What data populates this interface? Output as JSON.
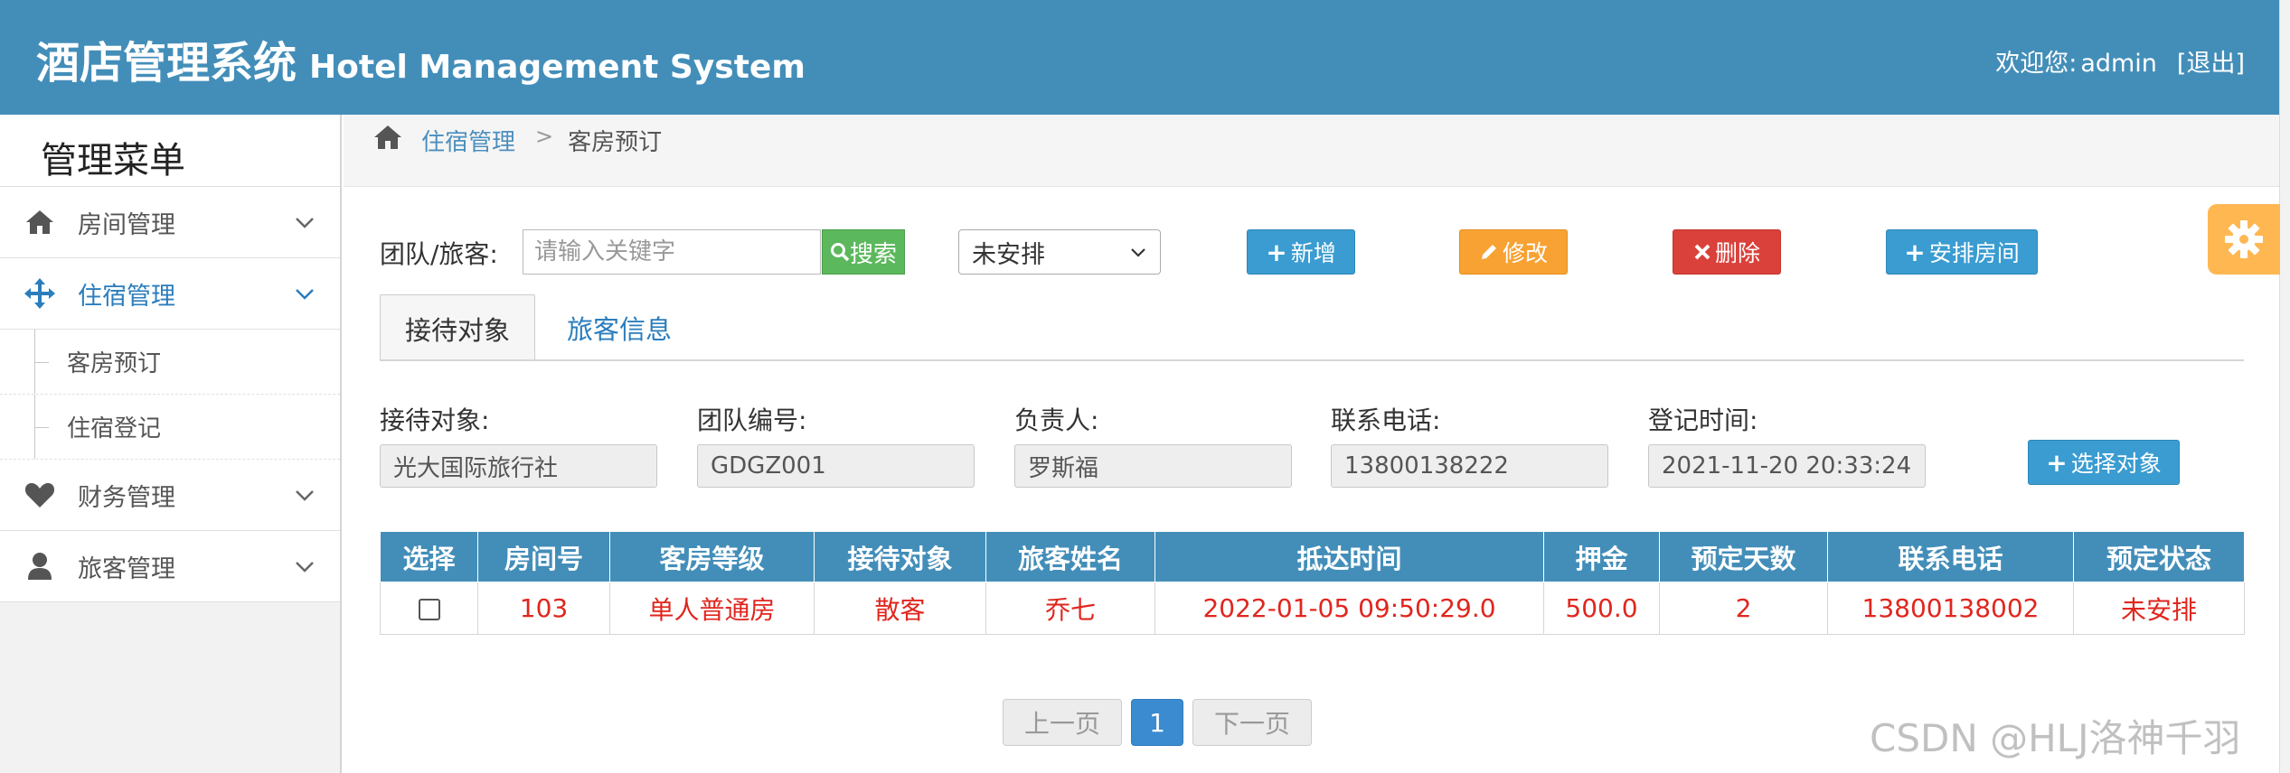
{
  "header": {
    "title_cn": "酒店管理系统",
    "title_en": "Hotel Management System",
    "welcome_prefix": "欢迎您:",
    "username": "admin",
    "logout": "[退出]",
    "bg_color": "#438eb9"
  },
  "sidebar": {
    "title": "管理菜单",
    "items": [
      {
        "label": "房间管理",
        "icon": "home-icon"
      },
      {
        "label": "住宿管理",
        "icon": "move-arrows-icon",
        "active": true
      },
      {
        "label": "财务管理",
        "icon": "heart-icon"
      },
      {
        "label": "旅客管理",
        "icon": "user-icon"
      }
    ],
    "subitems": [
      {
        "label": "客房预订"
      },
      {
        "label": "住宿登记"
      }
    ]
  },
  "breadcrumb": {
    "parent": "住宿管理",
    "current": "客房预订",
    "separator": ">"
  },
  "toolbar": {
    "filter_label": "团队/旅客:",
    "search_placeholder": "请输入关键字",
    "search_button": "搜索",
    "status_select_value": "未安排",
    "add_button": "新增",
    "edit_button": "修改",
    "delete_button": "删除",
    "arrange_room_button": "安排房间"
  },
  "tabs": [
    {
      "label": "接待对象",
      "active": true
    },
    {
      "label": "旅客信息",
      "active": false
    }
  ],
  "reception": {
    "fields": [
      {
        "label": "接待对象:",
        "value": "光大国际旅行社"
      },
      {
        "label": "团队编号:",
        "value": "GDGZ001"
      },
      {
        "label": "负责人:",
        "value": "罗斯福"
      },
      {
        "label": "联系电话:",
        "value": "13800138222"
      },
      {
        "label": "登记时间:",
        "value": "2021-11-20 20:33:24"
      }
    ],
    "select_button": "选择对象"
  },
  "table": {
    "headers": [
      "选择",
      "房间号",
      "客房等级",
      "接待对象",
      "旅客姓名",
      "抵达时间",
      "押金",
      "预定天数",
      "联系电话",
      "预定状态"
    ],
    "rows": [
      {
        "room_no": "103",
        "room_level": "单人普通房",
        "reception": "散客",
        "guest_name": "乔七",
        "arrival_time": "2022-01-05 09:50:29.0",
        "deposit": "500.0",
        "days": "2",
        "phone": "13800138002",
        "status": "未安排"
      }
    ]
  },
  "pagination": {
    "prev": "上一页",
    "current": "1",
    "next": "下一页"
  },
  "watermark": "CSDN @HLJ洛神千羽"
}
